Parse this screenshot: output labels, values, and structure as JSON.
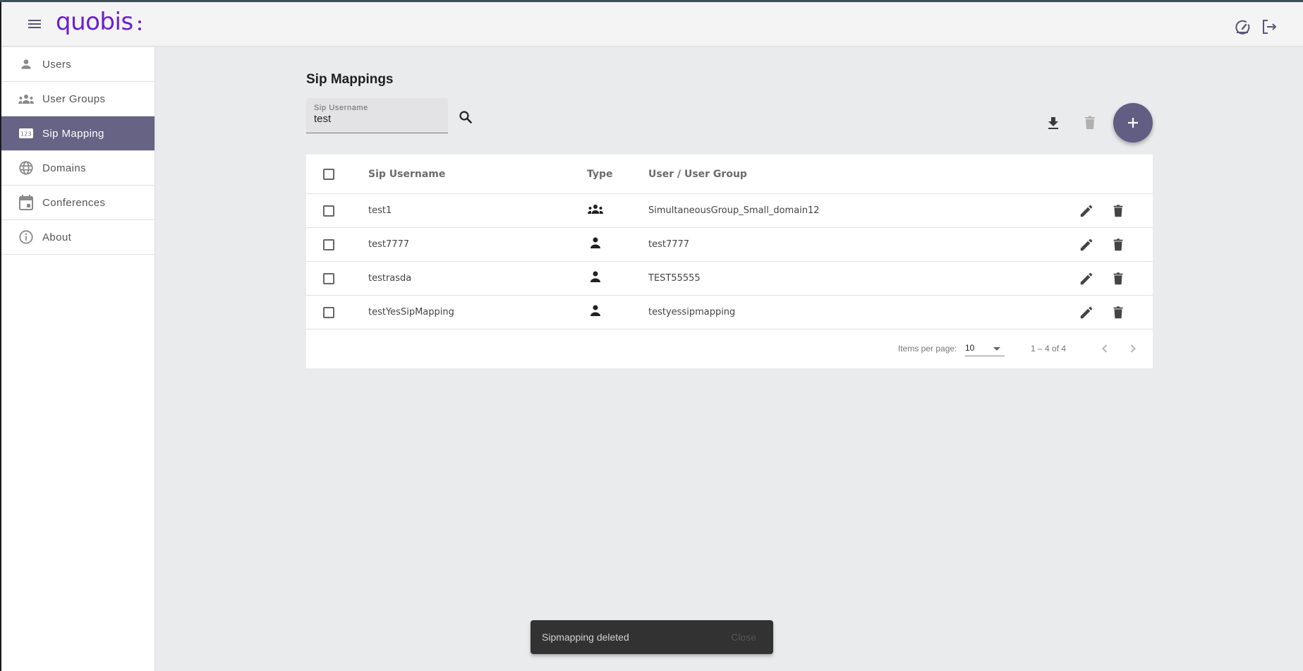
{
  "header": {
    "logo": "quobis",
    "icons": [
      "menu-icon",
      "dashboard-speedometer-icon",
      "logout-icon"
    ]
  },
  "colors": {
    "brand": "#6a1fd0",
    "accent": "#625d82",
    "sidebar_active": "#676385",
    "snackbar_bg": "#323232"
  },
  "sidebar": {
    "items": [
      {
        "label": "Users",
        "icon": "person-icon",
        "active": false
      },
      {
        "label": "User Groups",
        "icon": "groups-icon",
        "active": false
      },
      {
        "label": "Sip Mapping",
        "icon": "pin-123-icon",
        "active": true
      },
      {
        "label": "Domains",
        "icon": "globe-icon",
        "active": false
      },
      {
        "label": "Conferences",
        "icon": "calendar-icon",
        "active": false
      },
      {
        "label": "About",
        "icon": "info-icon",
        "active": false
      }
    ]
  },
  "main": {
    "title": "Sip Mappings",
    "search": {
      "label": "Sip Username",
      "value": "test"
    },
    "table": {
      "columns": [
        "Sip Username",
        "Type",
        "User / User Group"
      ],
      "rows": [
        {
          "sip_username": "test1",
          "type": "group",
          "user_or_group": "SimultaneousGroup_Small_domain12"
        },
        {
          "sip_username": "test7777",
          "type": "user",
          "user_or_group": "test7777"
        },
        {
          "sip_username": "testrasda",
          "type": "user",
          "user_or_group": "TEST55555"
        },
        {
          "sip_username": "testYesSipMapping",
          "type": "user",
          "user_or_group": "testyessipmapping"
        }
      ]
    },
    "paginator": {
      "items_per_page_label": "Items per page:",
      "items_per_page": "10",
      "range": "1 – 4 of 4"
    }
  },
  "snackbar": {
    "message": "Sipmapping deleted",
    "action": "Close"
  }
}
